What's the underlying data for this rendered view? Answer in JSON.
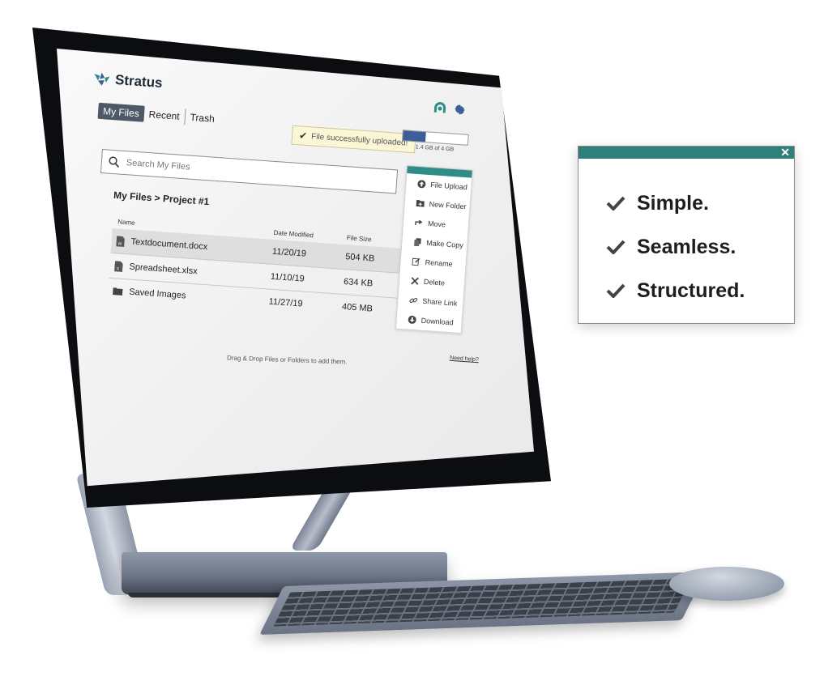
{
  "app": {
    "name": "Stratus"
  },
  "tabs": [
    {
      "label": "My Files",
      "active": true
    },
    {
      "label": "Recent"
    },
    {
      "label": "Trash"
    }
  ],
  "toast": {
    "text": "File successfully uploaded!"
  },
  "storage": {
    "text": "1.4 GB of 4 GB",
    "fraction": 0.35,
    "color": "#3c5f9a"
  },
  "search": {
    "placeholder": "Search My Files"
  },
  "breadcrumb": "My Files > Project #1",
  "table": {
    "headers": [
      "Name",
      "Date Modified",
      "File Size"
    ],
    "rows": [
      {
        "name": "Textdocument.docx",
        "date": "11/20/19",
        "size": "504 KB",
        "icon": "word-file-icon",
        "selected": true
      },
      {
        "name": "Spreadsheet.xlsx",
        "date": "11/10/19",
        "size": "634 KB",
        "icon": "excel-file-icon"
      },
      {
        "name": "Saved Images",
        "date": "11/27/19",
        "size": "405 MB",
        "icon": "folder-icon"
      }
    ]
  },
  "actions": [
    {
      "label": "File Upload",
      "icon": "upload-icon"
    },
    {
      "label": "New Folder",
      "icon": "new-folder-icon"
    },
    {
      "label": "Move",
      "icon": "move-icon"
    },
    {
      "label": "Make Copy",
      "icon": "copy-icon"
    },
    {
      "label": "Rename",
      "icon": "rename-icon"
    },
    {
      "label": "Delete",
      "icon": "delete-icon"
    },
    {
      "label": "Share Link",
      "icon": "link-icon"
    },
    {
      "label": "Download",
      "icon": "download-icon"
    }
  ],
  "drop_note": "Drag & Drop Files or Folders to add them.",
  "help_link": "Need help?",
  "feature_panel": {
    "items": [
      "Simple.",
      "Seamless.",
      "Structured."
    ],
    "accent": "#2f7f7a"
  }
}
